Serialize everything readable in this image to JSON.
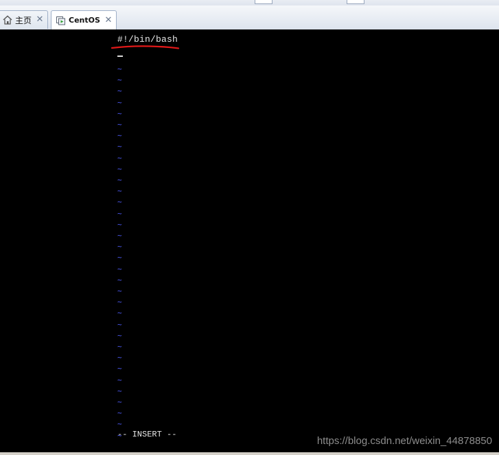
{
  "tabs": [
    {
      "label": "主页",
      "icon": "home-icon",
      "active": false
    },
    {
      "label": "CentOS",
      "icon": "vm-console-icon",
      "active": true
    }
  ],
  "editor": {
    "first_line": "#!/bin/bash",
    "empty_line_marker": "~",
    "empty_line_count": 34,
    "mode_text": "-- INSERT --"
  },
  "colors": {
    "terminal_background": "#000000",
    "text": "#e8e8e8",
    "tilde": "#4f5dff",
    "annotation_underline": "#e01818"
  },
  "watermark": "https://blog.csdn.net/weixin_44878850"
}
